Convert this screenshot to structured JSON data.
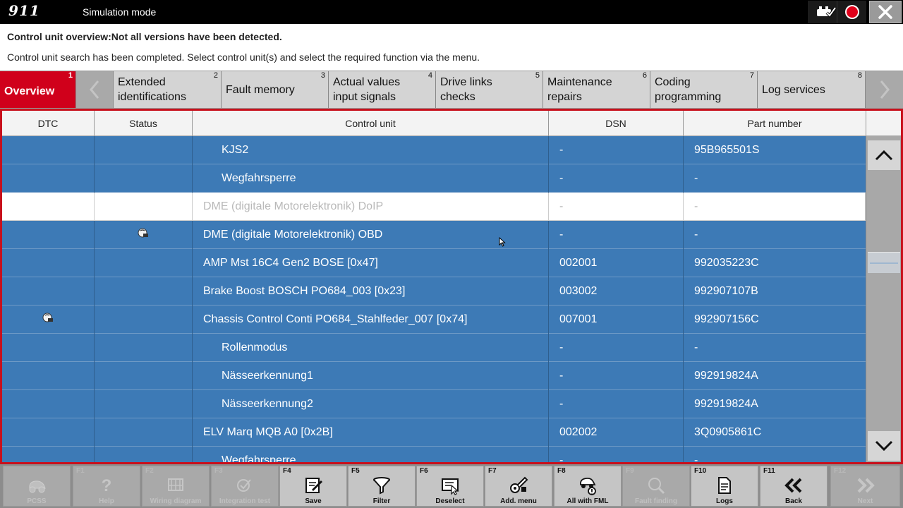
{
  "titlebar": {
    "logo": "911",
    "title": "Simulation mode",
    "buttons": [
      {
        "icon": "vehicle-check-icon"
      },
      {
        "icon": "record-icon"
      },
      {
        "icon": "close-icon"
      }
    ]
  },
  "info": {
    "headline": "Control unit overview:Not all versions have been detected.",
    "message": "Control unit search has been completed. Select control unit(s) and select the required function via the menu."
  },
  "tabs": [
    {
      "num": "1",
      "label": "Overview"
    },
    {
      "num": "2",
      "line1": "Extended",
      "line2": "identifications"
    },
    {
      "num": "3",
      "label": "Fault memory"
    },
    {
      "num": "4",
      "line1": "Actual values",
      "line2": "input signals"
    },
    {
      "num": "5",
      "line1": "Drive links",
      "line2": "checks"
    },
    {
      "num": "6",
      "line1": "Maintenance",
      "line2": "repairs"
    },
    {
      "num": "7",
      "line1": "Coding",
      "line2": "programming"
    },
    {
      "num": "8",
      "label": "Log services"
    }
  ],
  "table": {
    "headers": [
      "DTC",
      "Status",
      "Control unit",
      "DSN",
      "Part number"
    ],
    "rows": [
      {
        "dtc": "",
        "status": "",
        "cu": "KJS2",
        "dsn": "-",
        "pn": "95B965501S"
      },
      {
        "dtc": "",
        "status": "",
        "cu": "Wegfahrsperre",
        "dsn": "-",
        "pn": "-"
      },
      {
        "dtc": "",
        "status": "",
        "cu": "DME (digitale Motorelektronik) DoIP",
        "dsn": "-",
        "pn": "-"
      },
      {
        "dtc": "",
        "status": "",
        "cu": "DME (digitale Motorelektronik) OBD",
        "dsn": "-",
        "pn": "-"
      },
      {
        "dtc": "",
        "status": "",
        "cu": "AMP Mst 16C4 Gen2 BOSE [0x47]",
        "dsn": "002001",
        "pn": "992035223C"
      },
      {
        "dtc": "",
        "status": "",
        "cu": "Brake Boost BOSCH PO684_003 [0x23]",
        "dsn": "003002",
        "pn": "992907107B"
      },
      {
        "dtc": "",
        "status": "",
        "cu": "Chassis Control Conti PO684_Stahlfeder_007 [0x74]",
        "dsn": "007001",
        "pn": "992907156C"
      },
      {
        "dtc": "",
        "status": "",
        "cu": "Rollenmodus",
        "dsn": "-",
        "pn": "-"
      },
      {
        "dtc": "",
        "status": "",
        "cu": "Nässeerkennung1",
        "dsn": "-",
        "pn": "992919824A"
      },
      {
        "dtc": "",
        "status": "",
        "cu": "Nässeerkennung2",
        "dsn": "-",
        "pn": "992919824A"
      },
      {
        "dtc": "",
        "status": "",
        "cu": "ELV Marq MQB A0 [0x2B]",
        "dsn": "002002",
        "pn": "3Q0905861C"
      },
      {
        "dtc": "",
        "status": "",
        "cu": "Wegfahrsperre",
        "dsn": "-",
        "pn": "-"
      }
    ]
  },
  "scrollbar": {
    "up_icon": "chevron-up-icon",
    "down_icon": "chevron-down-icon"
  },
  "fkeys": [
    {
      "key": "",
      "label": "PCSS",
      "icon": "car-diagnosis-icon",
      "enabled": false
    },
    {
      "key": "F1",
      "label": "Help",
      "icon": "help-icon",
      "enabled": false
    },
    {
      "key": "F2",
      "label": "Wiring diagram",
      "icon": "wiring-diagram-icon",
      "enabled": false
    },
    {
      "key": "F3",
      "label": "Integration test",
      "icon": "integration-test-icon",
      "enabled": false
    },
    {
      "key": "F4",
      "label": "Save",
      "icon": "save-icon",
      "enabled": true
    },
    {
      "key": "F5",
      "label": "Filter",
      "icon": "filter-icon",
      "enabled": true
    },
    {
      "key": "F6",
      "label": "Deselect",
      "icon": "deselect-icon",
      "enabled": true
    },
    {
      "key": "F7",
      "label": "Add. menu",
      "icon": "additional-menu-icon",
      "enabled": true
    },
    {
      "key": "F8",
      "label": "All with FML",
      "icon": "all-with-fml-icon",
      "enabled": true
    },
    {
      "key": "F9",
      "label": "Fault finding",
      "icon": "fault-finding-icon",
      "enabled": false
    },
    {
      "key": "F10",
      "label": "Logs",
      "icon": "logs-icon",
      "enabled": true
    },
    {
      "key": "F11",
      "label": "Back",
      "icon": "back-icon",
      "enabled": true
    },
    {
      "key": "F12",
      "label": "Next",
      "icon": "next-icon",
      "enabled": false
    }
  ],
  "colors": {
    "accent": "#d0001b",
    "row_selected": "#3d7ab6",
    "titlebar": "#000000"
  }
}
